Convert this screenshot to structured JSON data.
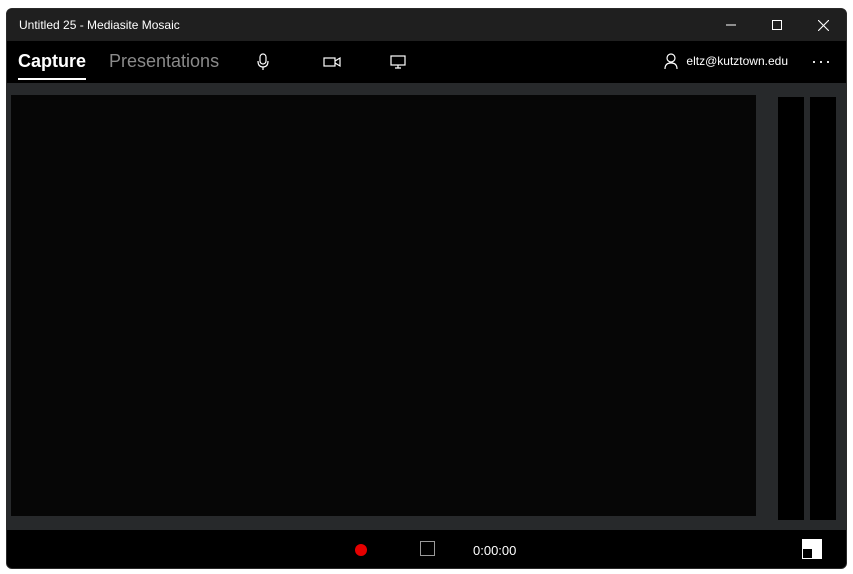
{
  "window": {
    "title": "Untitled 25 - Mediasite Mosaic"
  },
  "nav": {
    "tabs": [
      {
        "label": "Capture",
        "active": true
      },
      {
        "label": "Presentations",
        "active": false
      }
    ],
    "icons": [
      "microphone-icon",
      "camera-icon",
      "screen-icon"
    ],
    "user_email": "eltz@kutztown.edu",
    "more_icon": "more-icon"
  },
  "controls": {
    "timer": "0:00:00",
    "record_color": "#e60000"
  }
}
